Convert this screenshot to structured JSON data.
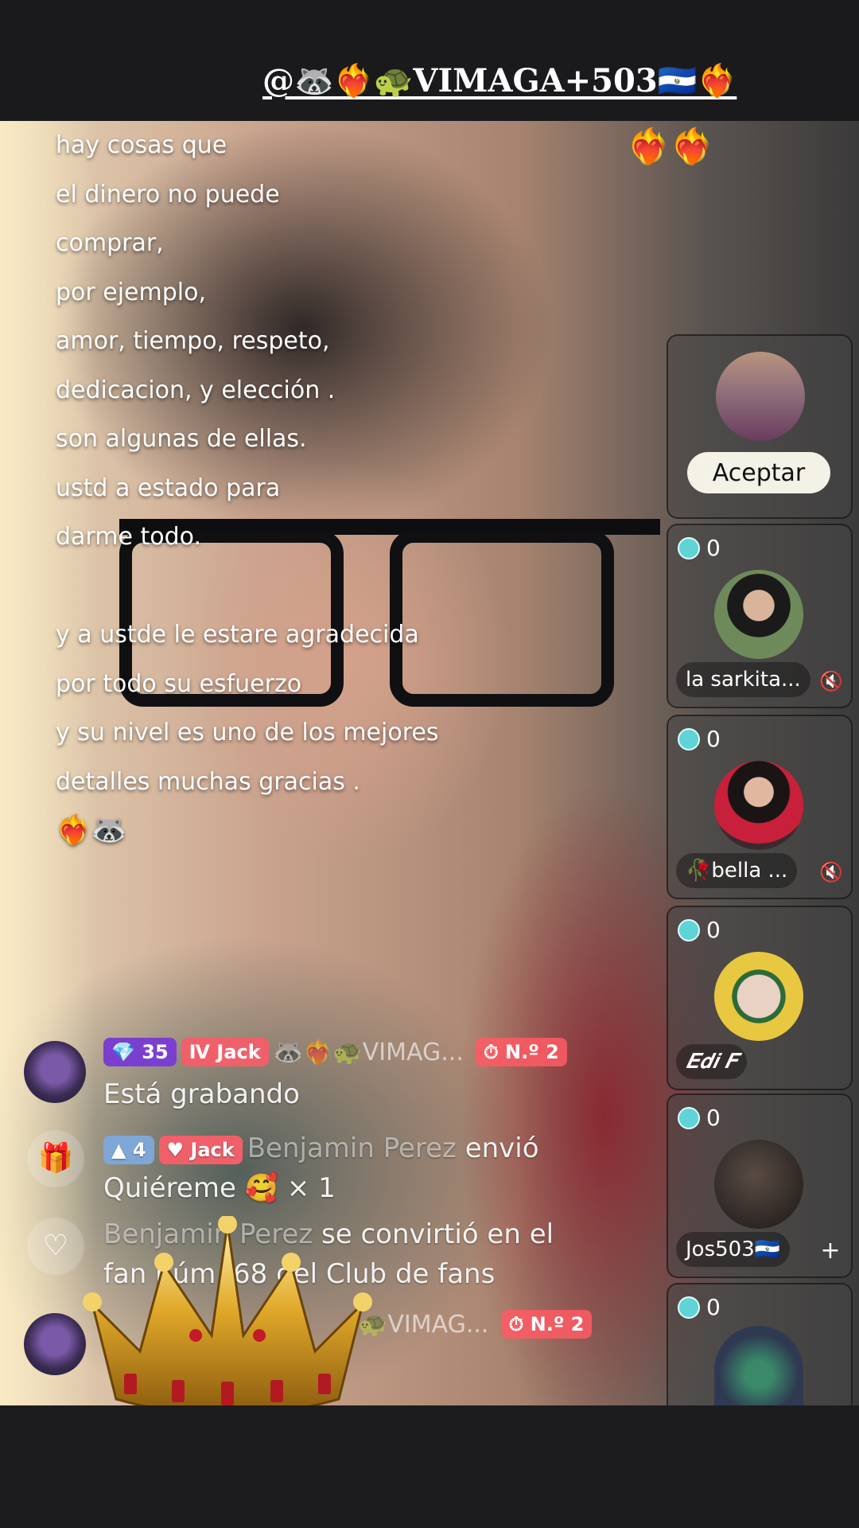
{
  "header": {
    "handle": "@🦝❤️‍🔥🐢VIMAGA+503🇸🇻❤️‍🔥"
  },
  "lyrics": [
    "hay cosas que",
    "el dinero no puede",
    "comprar,",
    "por ejemplo,",
    "amor, tiempo, respeto,",
    "dedicacion,  y elección .",
    "son algunas de ellas.",
    " ustd a estado para",
    "darme todo.",
    "",
    "y a ustde le estare agradecida",
    "por todo su esfuerzo",
    "y su nivel es uno de los mejores",
    "detalles muchas gracias .",
    "❤️‍🔥🦝"
  ],
  "top_hearts": "❤️‍🔥❤️‍🔥",
  "request": {
    "accept_label": "Aceptar"
  },
  "seats": [
    {
      "count": "0",
      "name": "la sarkita...",
      "muted": true,
      "avatar_color": "#6f8a5a"
    },
    {
      "count": "0",
      "name": "🥀bella ...",
      "muted": true,
      "avatar_color": "#7a2a38"
    },
    {
      "count": "0",
      "name": "𝑬𝒅𝒊 𝑭",
      "muted": false,
      "avatar_color": "#c9b040"
    },
    {
      "count": "0",
      "name": "Jos503🇸🇻",
      "muted": false,
      "avatar_color": "#3d3430",
      "plus": "+"
    },
    {
      "count": "0",
      "name": "",
      "muted": false,
      "avatar_color": "#2f3a52"
    }
  ],
  "chat": [
    {
      "type": "message",
      "level": "35",
      "fan_badge": "Jack",
      "user": "🦝❤️‍🔥🐢VIMAG...",
      "rank": "N.º 2",
      "text": "Está grabando"
    },
    {
      "type": "gift",
      "icon": "gift-icon",
      "level": "4",
      "fan_badge": "Jack",
      "user": "Benjamin Perez",
      "action": "envió",
      "text": "Quiéreme 🥰 × 1"
    },
    {
      "type": "fanclub",
      "icon": "heart-icon",
      "line1_dim": "Benjamin Perez",
      "line1": " se convirtió en el",
      "line2": "fan núm. 68 del Club de fans"
    },
    {
      "type": "message",
      "user": "🐢VIMAG...",
      "rank": "N.º 2"
    }
  ],
  "colors": {
    "accent_purple": "#7b3fd0",
    "accent_red": "#f0606a",
    "accept_bg": "#f4f1e6"
  }
}
